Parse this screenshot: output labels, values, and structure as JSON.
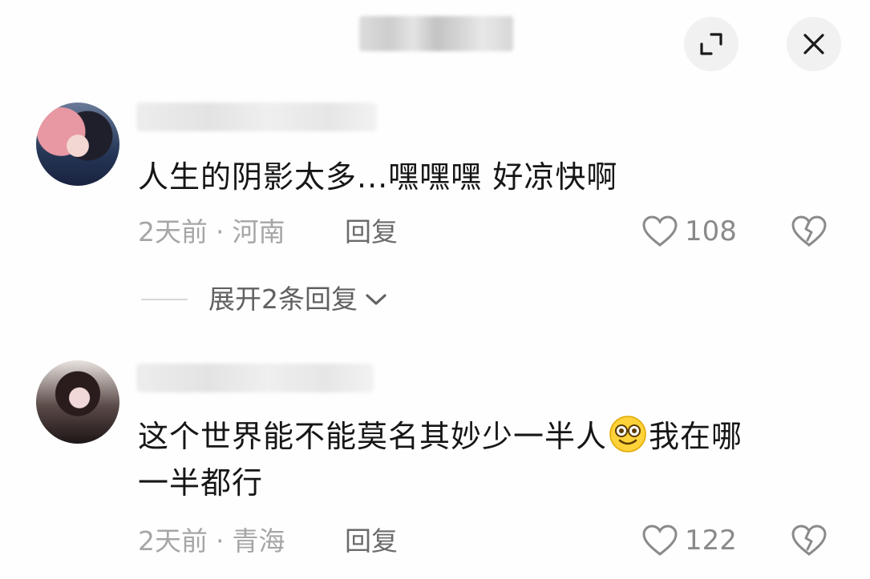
{
  "header": {
    "expand_icon": "expand-corner-icon",
    "close_icon": "close-x-icon"
  },
  "comments": [
    {
      "text": "人生的阴影太多...嘿嘿嘿 好凉快啊",
      "time": "2天前",
      "separator": "·",
      "location": "河南",
      "reply_label": "回复",
      "likes": "108"
    },
    {
      "text_part1": "这个世界能不能莫名其妙少一半人",
      "text_part2": "我在哪",
      "text_line2": "一半都行",
      "emoji": "smiling-face-emoji",
      "time": "2天前",
      "separator": "·",
      "location": "青海",
      "reply_label": "回复",
      "likes": "122"
    }
  ],
  "expand_replies": {
    "label": "展开2条回复"
  },
  "colors": {
    "meta_gray": "#a6a6a6",
    "button_bg": "#f1f1f1",
    "text": "#161616"
  }
}
